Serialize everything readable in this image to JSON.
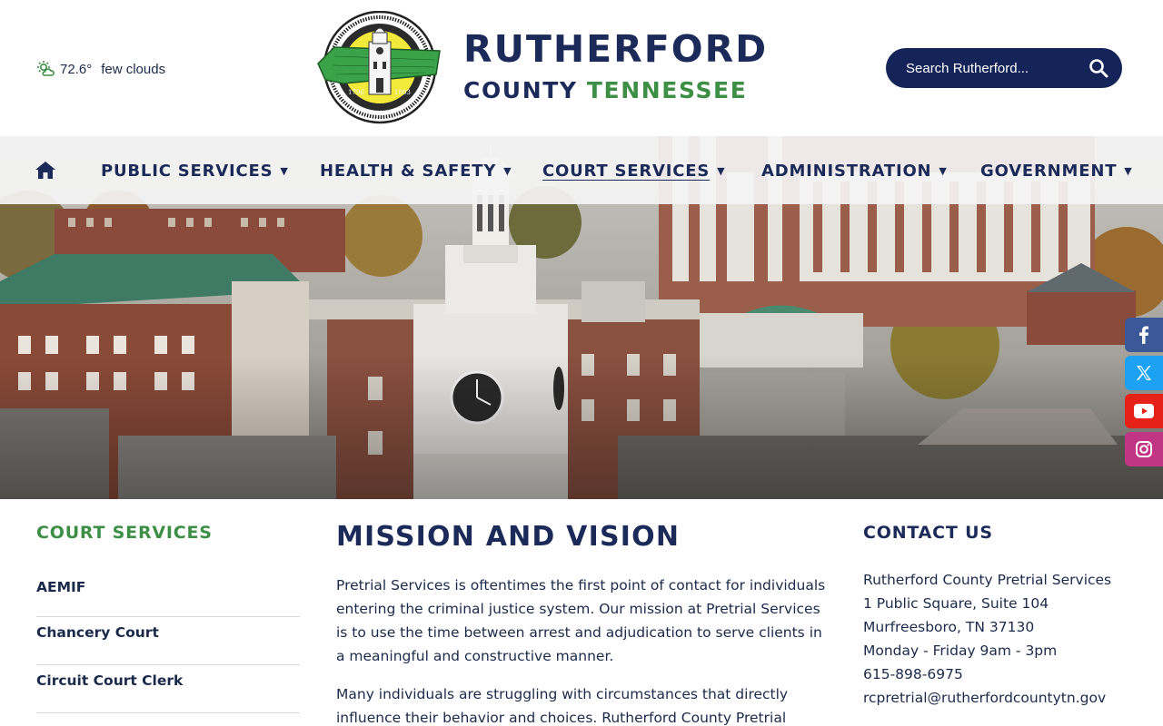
{
  "weather": {
    "temperature": "72.6°",
    "condition": "few clouds",
    "icon": "partly-cloudy-icon"
  },
  "brand": {
    "seal_name": "county-seal-logo",
    "seal_text": "Rutherford County Tennessee",
    "seal_years": [
      "1796",
      "1803"
    ],
    "line1": "RUTHERFORD",
    "line2_county": "COUNTY",
    "line2_state": "TENNESSEE",
    "colors": {
      "navy": "#1b2a58",
      "green": "#3c8f45"
    }
  },
  "search": {
    "placeholder": "Search Rutherford...",
    "icon": "search-icon"
  },
  "nav": {
    "home_icon": "home-icon",
    "items": [
      {
        "label": "PUBLIC SERVICES",
        "arrow": "▼"
      },
      {
        "label": "HEALTH & SAFETY",
        "arrow": "▼"
      },
      {
        "label": "COURT SERVICES",
        "arrow": "▼",
        "active": true
      },
      {
        "label": "ADMINISTRATION",
        "arrow": "▼"
      },
      {
        "label": "GOVERNMENT",
        "arrow": "▼"
      }
    ]
  },
  "social": [
    {
      "icon": "facebook-icon",
      "color": "#3b5998"
    },
    {
      "icon": "x-twitter-icon",
      "color": "#1da1f2"
    },
    {
      "icon": "youtube-icon",
      "color": "#e62117"
    },
    {
      "icon": "instagram-icon",
      "color": "#c13584"
    }
  ],
  "sidebar": {
    "title": "COURT SERVICES",
    "items": [
      "AEMIF",
      "Chancery Court",
      "Circuit Court Clerk"
    ]
  },
  "main": {
    "title": "MISSION AND VISION",
    "paragraphs": [
      "Pretrial Services is oftentimes the first point of contact for individuals entering the criminal justice system. Our mission at Pretrial Services is to use the time between arrest and adjudication to serve clients in a meaningful and constructive manner.",
      "Many individuals are struggling with circumstances that directly influence their behavior and choices. Rutherford County Pretrial"
    ]
  },
  "contact": {
    "title": "CONTACT US",
    "lines": [
      "Rutherford County Pretrial Services",
      "1 Public Square, Suite 104",
      "Murfreesboro, TN 37130",
      "Monday - Friday 9am - 3pm",
      "615-898-6975",
      "rcpretrial@rutherfordcountytn.gov"
    ]
  }
}
